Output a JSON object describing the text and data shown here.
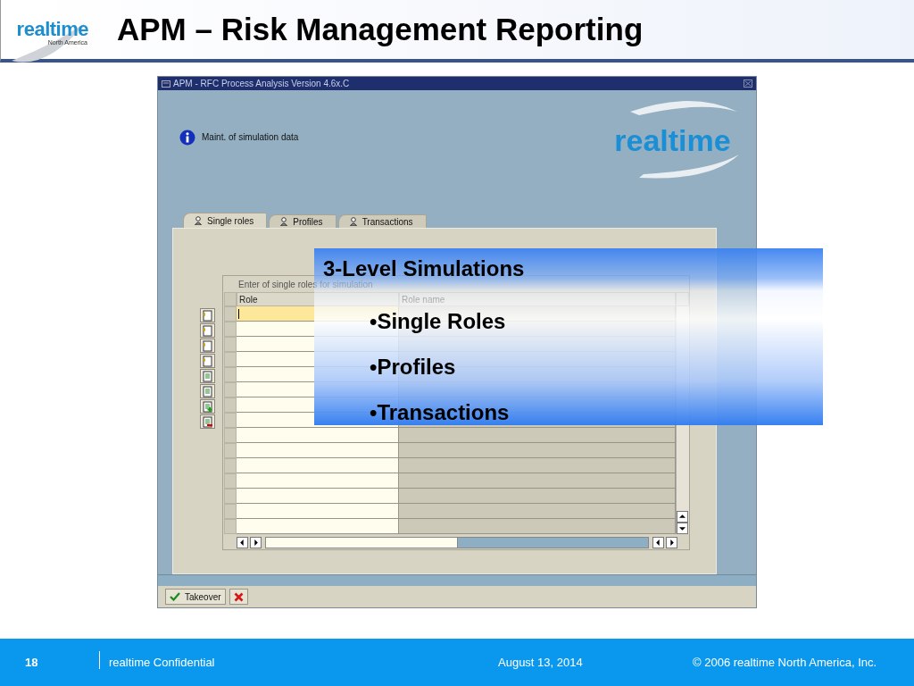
{
  "slide": {
    "title": "APM – Risk Management Reporting",
    "logo": {
      "name": "realtime",
      "tagline": "North America"
    }
  },
  "window": {
    "title": "APM - RFC Process Analysis Version 4.6x.C",
    "message": "Maint. of simulation data",
    "logo": "realtime",
    "tabs": [
      {
        "label": "Single roles",
        "selected": true
      },
      {
        "label": "Profiles",
        "selected": false
      },
      {
        "label": "Transactions",
        "selected": false
      }
    ],
    "table": {
      "title": "Enter of single roles for simulation",
      "columns": [
        "Role",
        "Role name"
      ],
      "rows": [
        {
          "selected": true
        },
        {
          "selected": false
        },
        {
          "selected": false
        },
        {
          "selected": false
        },
        {
          "selected": false
        },
        {
          "selected": false
        },
        {
          "selected": false
        },
        {
          "selected": false
        },
        {
          "selected": false
        },
        {
          "selected": false
        },
        {
          "selected": false
        },
        {
          "selected": false
        },
        {
          "selected": false
        },
        {
          "selected": false
        },
        {
          "selected": false
        }
      ]
    },
    "buttons": [
      {
        "kind": "confirm",
        "label": "Takeover"
      },
      {
        "kind": "cancel"
      }
    ]
  },
  "callout": {
    "title": "3-Level Simulations",
    "bullets": [
      "•Single Roles",
      "•Profiles",
      "•Transactions"
    ]
  },
  "footer": {
    "page": "18",
    "confidential": "realtime Confidential",
    "date": "August 13, 2014",
    "copyright": "© 2006 realtime North America, Inc."
  }
}
